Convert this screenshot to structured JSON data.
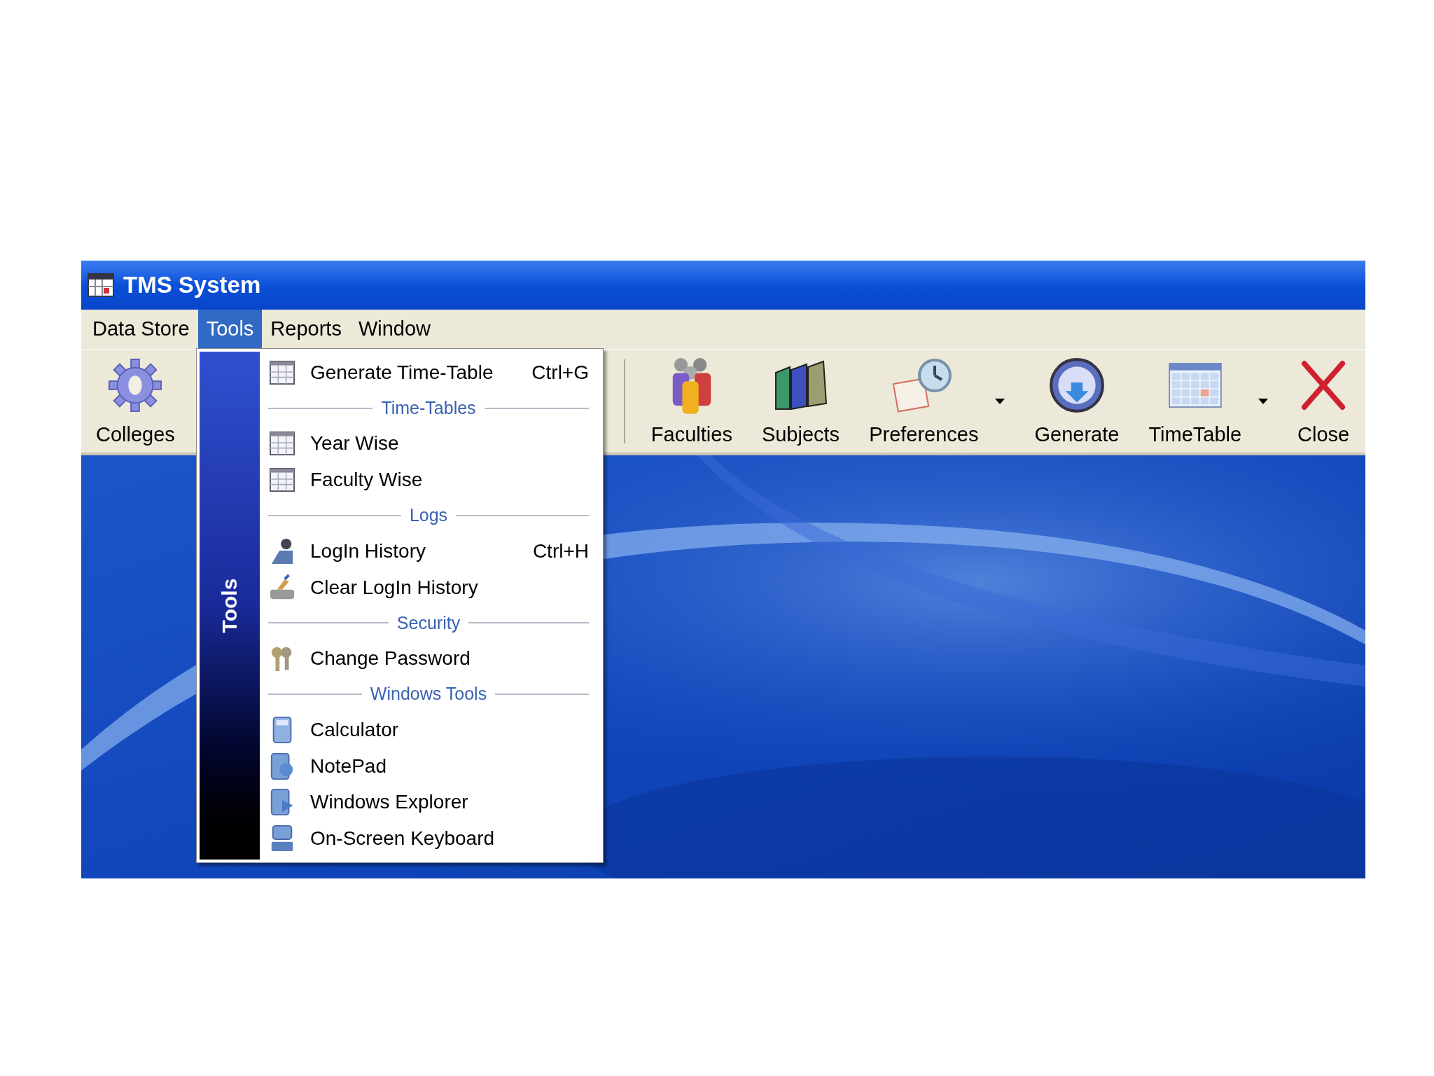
{
  "window": {
    "title": "TMS System"
  },
  "menu_bar": [
    {
      "label": "Data Store",
      "selected": false
    },
    {
      "label": "Tools",
      "selected": true
    },
    {
      "label": "Reports",
      "selected": false
    },
    {
      "label": "Window",
      "selected": false
    }
  ],
  "toolbar": [
    {
      "label": "Colleges",
      "kind": "gear",
      "dropdown": false
    },
    {
      "label": "Faculties",
      "kind": "people",
      "dropdown": false
    },
    {
      "label": "Subjects",
      "kind": "books",
      "dropdown": false
    },
    {
      "label": "Preferences",
      "kind": "clock",
      "dropdown": true
    },
    {
      "label": "Generate",
      "kind": "globe",
      "dropdown": false
    },
    {
      "label": "TimeTable",
      "kind": "calendar",
      "dropdown": true
    },
    {
      "label": "Close",
      "kind": "close",
      "dropdown": false
    }
  ],
  "tools_menu": {
    "sidebar_label": "Tools",
    "items": [
      {
        "kind": "item",
        "label": "Generate Time-Table",
        "shortcut": "Ctrl+G"
      },
      {
        "kind": "header",
        "label": "Time-Tables"
      },
      {
        "kind": "item",
        "label": "Year Wise"
      },
      {
        "kind": "item",
        "label": "Faculty Wise"
      },
      {
        "kind": "header",
        "label": "Logs"
      },
      {
        "kind": "item",
        "label": "LogIn History",
        "shortcut": "Ctrl+H"
      },
      {
        "kind": "item",
        "label": "Clear LogIn History"
      },
      {
        "kind": "header",
        "label": "Security"
      },
      {
        "kind": "item",
        "label": "Change Password"
      },
      {
        "kind": "header",
        "label": "Windows Tools"
      },
      {
        "kind": "item",
        "label": "Calculator"
      },
      {
        "kind": "item",
        "label": "NotePad"
      },
      {
        "kind": "item",
        "label": "Windows Explorer"
      },
      {
        "kind": "item",
        "label": "On-Screen Keyboard"
      }
    ]
  }
}
